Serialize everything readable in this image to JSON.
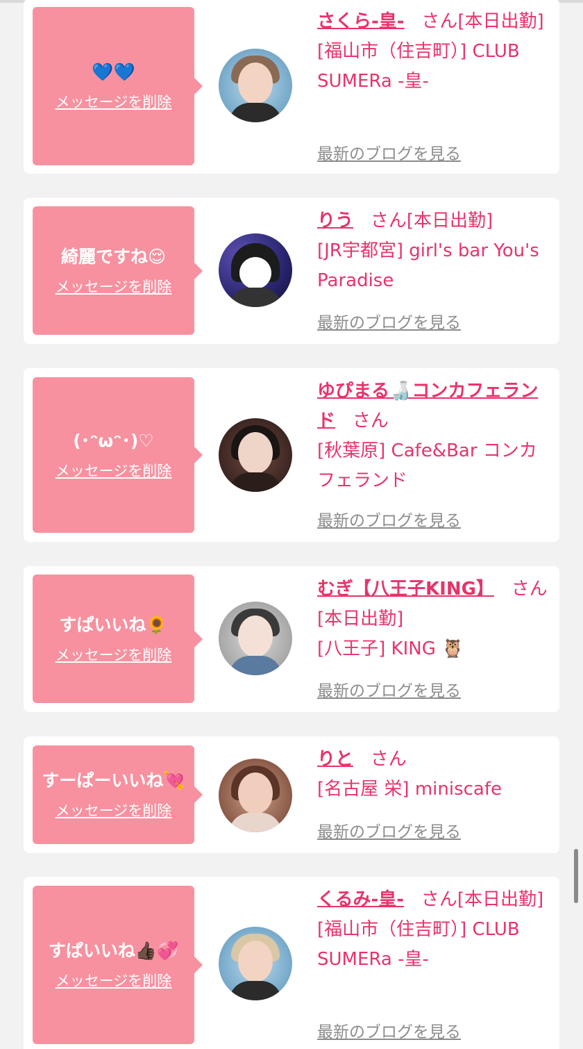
{
  "cards": [
    {
      "message": "💙💙",
      "delete_label": "メッセージを削除",
      "name": "さくら-皇-",
      "suffix": "さん[本日出勤]",
      "shop": "[福山市（住吉町）] CLUB SUMERa -皇-",
      "blog_label": "最新のブログを見る",
      "avatar": "avatar-photo-glitter-bg"
    },
    {
      "message": "綺麗ですね😌",
      "delete_label": "メッセージを削除",
      "name": "りう",
      "suffix": "さん[本日出勤]",
      "shop": "[JR宇都宮] girl's bar You's Paradise",
      "blog_label": "最新のブログを見る",
      "avatar": "avatar-photo-heart-sticker"
    },
    {
      "message": "(･ᵔωᵔ･)♡",
      "delete_label": "メッセージを削除",
      "name": "ゆぴまる🍶コンカフェランド",
      "suffix": "さん",
      "shop": "[秋葉原] Cafe&Bar コンカフェランド",
      "blog_label": "最新のブログを見る",
      "avatar": "avatar-photo-dark"
    },
    {
      "message": "すぱいいね🌻",
      "delete_label": "メッセージを削除",
      "name": "むぎ【八王子KING】",
      "suffix": "さん[本日出勤]",
      "shop": "[八王子] KING 🦉",
      "blog_label": "最新のブログを見る",
      "avatar": "avatar-photo-sticker"
    },
    {
      "message": "すーぱーいいね💘",
      "delete_label": "メッセージを削除",
      "name": "りと",
      "suffix": "さん",
      "shop": "[名古屋 栄] miniscafe",
      "blog_label": "最新のブログを見る",
      "avatar": "avatar-photo-warm"
    },
    {
      "message": "すぱいいね👍🏿💞",
      "delete_label": "メッセージを削除",
      "name": "くるみ-皇-",
      "suffix": "さん[本日出勤]",
      "shop": "[福山市（住吉町）] CLUB SUMERa -皇-",
      "blog_label": "最新のブログを見る",
      "avatar": "avatar-photo-glitter-bg"
    }
  ],
  "colors": {
    "bubble": "#f7919f",
    "accent": "#e8336a",
    "muted": "#8c8c8c",
    "background": "#f2f2f2"
  }
}
